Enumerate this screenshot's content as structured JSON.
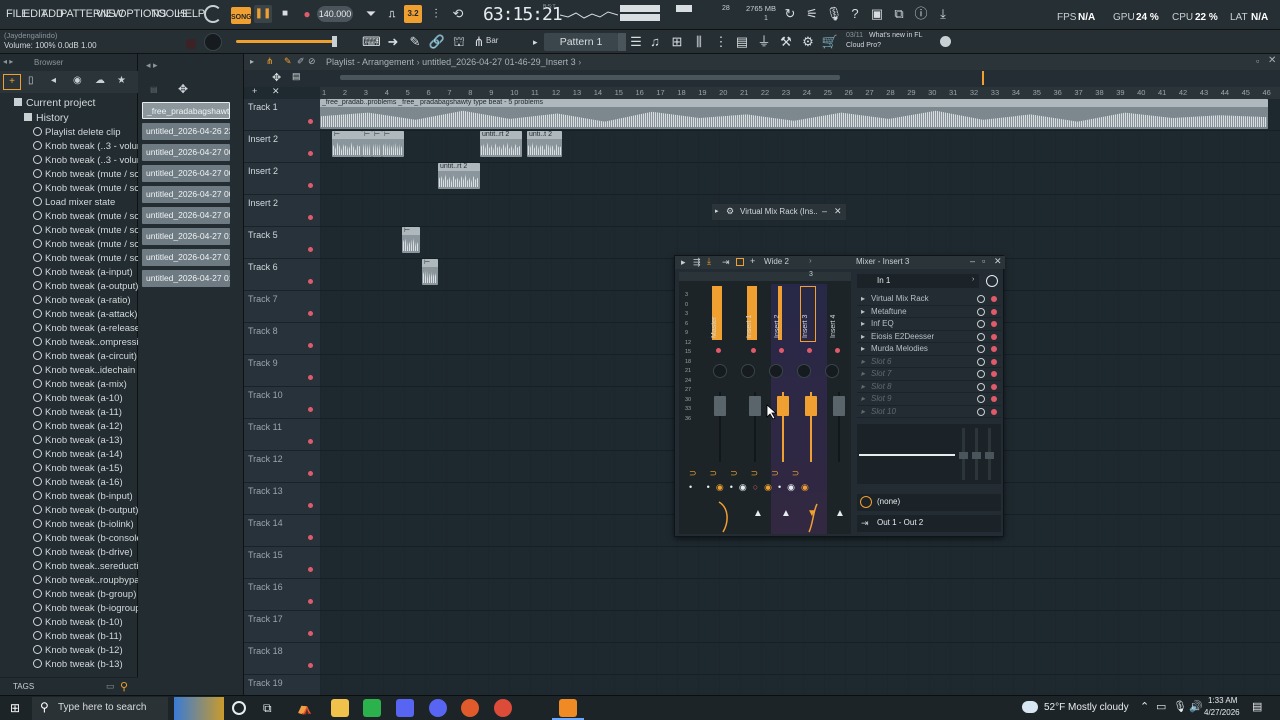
{
  "menu": [
    "FILE",
    "EDIT",
    "ADD",
    "PATTERNS",
    "VIEW",
    "OPTIONS",
    "TOOLS",
    "HELP"
  ],
  "transport": {
    "mode": "SONG",
    "tempo": "140.000",
    "time": "63:15:21",
    "time_sub": "B:S:T",
    "pattern_len": "3.2",
    "mem": "2765 MB",
    "cpu_small": "28",
    "voices": "1"
  },
  "status": {
    "fps_label": "FPS",
    "fps_value": "N/A",
    "gpu_label": "GPU",
    "gpu_value": "24 %",
    "cpu_label": "CPU",
    "cpu_value": "22 %",
    "lat_label": "LAT",
    "lat_value": "N/A"
  },
  "hint": {
    "user": "(Jaydengalindo)",
    "volume": "Volume: 100% 0.0dB 1.00"
  },
  "secondbar": {
    "snap": "Bar",
    "pattern": "Pattern 1",
    "news_date": "03/11",
    "news_line1": "What's new in FL",
    "news_line2": "Cloud Pro?"
  },
  "browser": {
    "title": "Browser",
    "root": "Current project",
    "history": "History",
    "items": [
      "Playlist delete clip",
      "Knob tweak (..3 - volume)",
      "Knob tweak (..3 - volume)",
      "Knob tweak (mute / solo)",
      "Knob tweak (mute / solo)",
      "Load mixer state",
      "Knob tweak (mute / solo)",
      "Knob tweak (mute / solo)",
      "Knob tweak (mute / solo)",
      "Knob tweak (mute / solo)",
      "Knob tweak (a-input)",
      "Knob tweak (a-output)",
      "Knob tweak (a-ratio)",
      "Knob tweak (a-attack)",
      "Knob tweak (a-release)",
      "Knob tweak..ompression)",
      "Knob tweak (a-circuit)",
      "Knob tweak..idechain hp)",
      "Knob tweak (a-mix)",
      "Knob tweak (a-10)",
      "Knob tweak (a-11)",
      "Knob tweak (a-12)",
      "Knob tweak (a-13)",
      "Knob tweak (a-14)",
      "Knob tweak (a-15)",
      "Knob tweak (a-16)",
      "Knob tweak (b-input)",
      "Knob tweak (b-output)",
      "Knob tweak (b-iolink)",
      "Knob tweak (b-console)",
      "Knob tweak (b-drive)",
      "Knob tweak..sereduction)",
      "Knob tweak..roupbypass)",
      "Knob tweak (b-group)",
      "Knob tweak (b-iogroup)",
      "Knob tweak (b-10)",
      "Knob tweak (b-11)",
      "Knob tweak (b-12)",
      "Knob tweak (b-13)"
    ],
    "tags": "TAGS"
  },
  "picker": [
    "_free_pradabagshawty t..",
    "untitled_2026-04-26 23-..",
    "untitled_2026-04-27 00-..",
    "untitled_2026-04-27 00-..",
    "untitled_2026-04-27 00-..",
    "untitled_2026-04-27 00-..",
    "untitled_2026-04-27 01-..",
    "untitled_2026-04-27 01-..",
    "untitled_2026-04-27 01-.."
  ],
  "playlist": {
    "title": "Playlist - Arrangement",
    "path": "untitled_2026-04-27 01-46-29_Insert 3",
    "ruler": [
      "1",
      "2",
      "3",
      "4",
      "5",
      "6",
      "7",
      "8",
      "9",
      "10",
      "11",
      "12",
      "13",
      "14",
      "15",
      "16",
      "17",
      "18",
      "19",
      "20",
      "21",
      "22",
      "23",
      "24",
      "25",
      "26",
      "27",
      "28",
      "29",
      "30",
      "31",
      "32",
      "33",
      "34",
      "35",
      "36",
      "37",
      "38",
      "39",
      "40",
      "41",
      "42",
      "43",
      "44",
      "45",
      "46"
    ],
    "tracks": [
      "Track 1",
      "Insert 2",
      "Insert 2",
      "Insert 2",
      "Track 5",
      "Track 6",
      "Track 7",
      "Track 8",
      "Track 9",
      "Track 10",
      "Track 11",
      "Track 12",
      "Track 13",
      "Track 14",
      "Track 15",
      "Track 16",
      "Track 17",
      "Track 18",
      "Track 19"
    ],
    "clip_main": "_free_pradab..problems  _free_ pradabagshawty type beat - 5 problems",
    "clip_a": "untit..rt 2",
    "clip_b": "unti..t 2",
    "clip_c": "untit..rt 2"
  },
  "vmr": {
    "title": "Virtual Mix Rack (Ins.."
  },
  "mixer": {
    "view": "Wide 2",
    "title": "Mixer - Insert 3",
    "input": "In 1",
    "strips": [
      "Master",
      "Insert 1",
      "Insert 2",
      "Insert 3",
      "Insert 4"
    ],
    "scale": [
      "3",
      "0",
      "3",
      "6",
      "9",
      "12",
      "15",
      "18",
      "21",
      "24",
      "27",
      "30",
      "33",
      "36"
    ],
    "slots": [
      "Virtual Mix Rack",
      "Metaftune",
      "Inf EQ",
      "Eiosis E2Deesser",
      "Murda Melodies",
      "Slot 6",
      "Slot 7",
      "Slot 8",
      "Slot 9",
      "Slot 10"
    ],
    "send": "(none)",
    "output": "Out 1 - Out 2",
    "header_num": "3"
  },
  "taskbar": {
    "search": "Type here to search",
    "weather": "52°F  Mostly cloudy",
    "time": "1:33 AM",
    "date": "4/27/2026"
  }
}
